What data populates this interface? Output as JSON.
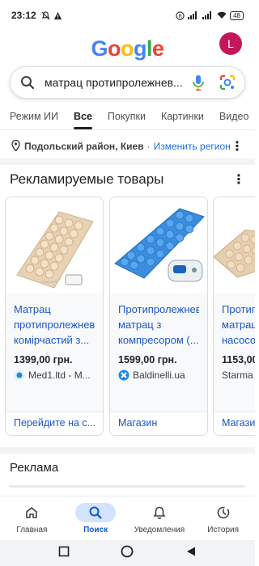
{
  "status_bar": {
    "time": "23:12",
    "battery": "48"
  },
  "header": {
    "logo_letters": [
      "G",
      "o",
      "o",
      "g",
      "l",
      "e"
    ],
    "avatar_initial": "L"
  },
  "search": {
    "query": "матрац протипролежнев..."
  },
  "tabs": [
    {
      "label": "Режим ИИ",
      "active": false
    },
    {
      "label": "Все",
      "active": true
    },
    {
      "label": "Покупки",
      "active": false
    },
    {
      "label": "Картинки",
      "active": false
    },
    {
      "label": "Видео",
      "active": false
    }
  ],
  "location": {
    "text": "Подольский район, Киев",
    "separator": "·",
    "change_label": "Изменить регион"
  },
  "ads_section": {
    "title": "Рекламируемые товары"
  },
  "products": [
    {
      "title": "Матрац протипролежнев комірчастий з...",
      "price": "1399,00 грн.",
      "seller": "Med1.ltd - M...",
      "cta": "Перейдите на с..."
    },
    {
      "title": "Протипролежнев матрац з компресором (...",
      "price": "1599,00 грн.",
      "seller": "Baldinelli.ua",
      "cta": "Магазин"
    },
    {
      "title": "Протиг матрац насосо",
      "price": "1153,00",
      "seller": "Starma",
      "cta": "Магази"
    }
  ],
  "ads_label": "Реклама",
  "bottom_nav": [
    {
      "label": "Главная",
      "icon": "home-icon",
      "active": false
    },
    {
      "label": "Поиск",
      "icon": "search-icon",
      "active": true
    },
    {
      "label": "Уведомления",
      "icon": "bell-icon",
      "active": false
    },
    {
      "label": "История",
      "icon": "history-icon",
      "active": false
    }
  ],
  "colors": {
    "link": "#1a56c7",
    "active_nav": "#0b57d0",
    "active_pill": "#d3e3fd",
    "avatar_bg": "#c2185b"
  }
}
